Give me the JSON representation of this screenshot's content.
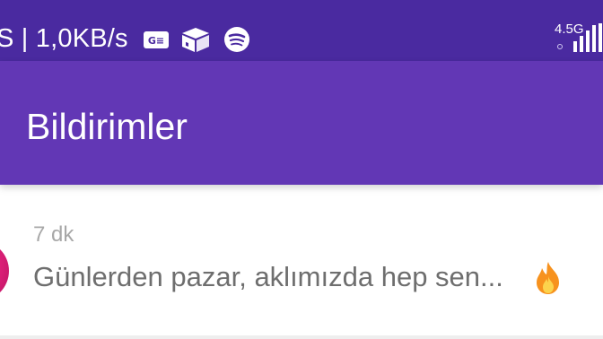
{
  "status_bar": {
    "speed_text": "S | 1,0KB/s",
    "network_type": "4.5G",
    "icons": [
      "ge-icon",
      "box-icon",
      "spotify-icon",
      "signal-icon"
    ],
    "background_color": "#4a2aa0"
  },
  "app_bar": {
    "title": "Bildirimler",
    "background_color": "#6237b5"
  },
  "notifications": [
    {
      "time": "7 dk",
      "message": "Günlerden pazar, aklımızda hep sen...",
      "emoji_icon": "fire-icon"
    }
  ]
}
